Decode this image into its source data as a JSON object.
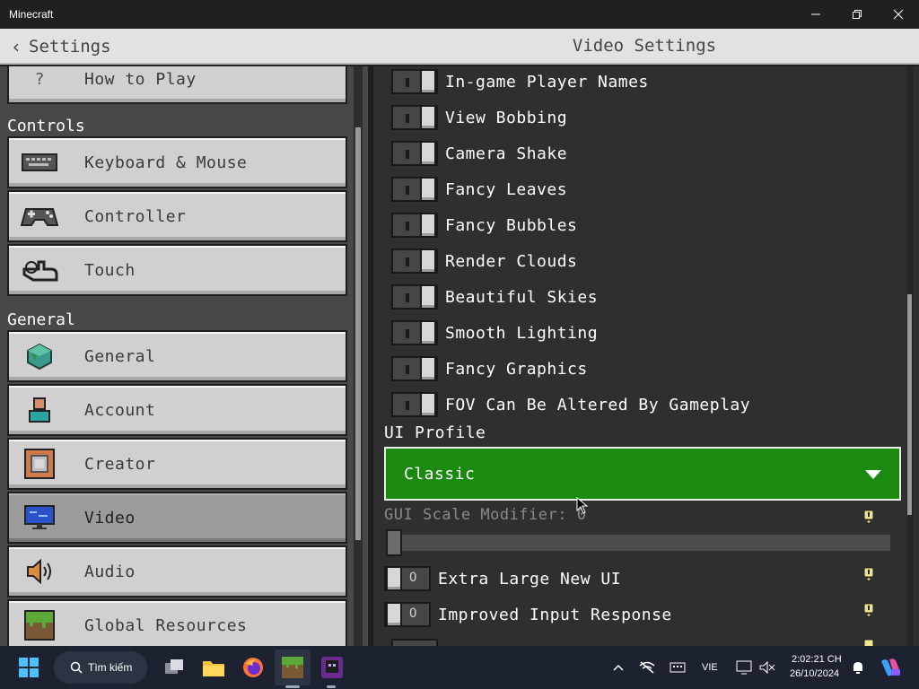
{
  "window": {
    "title": "Minecraft"
  },
  "header": {
    "back_label": "Settings",
    "title": "Video Settings"
  },
  "sidebar": {
    "partial_item": {
      "icon": "question-icon",
      "label": "How to Play",
      "icon_glyph": "?"
    },
    "sections": [
      {
        "title": "Controls",
        "items": [
          {
            "label": "Keyboard & Mouse",
            "icon": "keyboard-icon"
          },
          {
            "label": "Controller",
            "icon": "controller-icon"
          },
          {
            "label": "Touch",
            "icon": "touch-icon"
          }
        ]
      },
      {
        "title": "General",
        "items": [
          {
            "label": "General",
            "icon": "globe-cube-icon"
          },
          {
            "label": "Account",
            "icon": "account-icon"
          },
          {
            "label": "Creator",
            "icon": "creator-icon"
          },
          {
            "label": "Video",
            "icon": "monitor-icon",
            "selected": true
          },
          {
            "label": "Audio",
            "icon": "speaker-icon"
          },
          {
            "label": "Global Resources",
            "icon": "grass-block-icon"
          }
        ]
      }
    ]
  },
  "video": {
    "toggles": [
      {
        "label": "In-game Player Names",
        "state": "off"
      },
      {
        "label": "View Bobbing",
        "state": "off"
      },
      {
        "label": "Camera Shake",
        "state": "off"
      },
      {
        "label": "Fancy Leaves",
        "state": "off"
      },
      {
        "label": "Fancy Bubbles",
        "state": "off"
      },
      {
        "label": "Render Clouds",
        "state": "off"
      },
      {
        "label": "Beautiful Skies",
        "state": "off"
      },
      {
        "label": "Smooth Lighting",
        "state": "off"
      },
      {
        "label": "Fancy Graphics",
        "state": "off"
      },
      {
        "label": "FOV Can Be Altered By Gameplay",
        "state": "off"
      }
    ],
    "ui_profile_label": "UI Profile",
    "ui_profile_value": "Classic",
    "gui_scale_label": "GUI Scale Modifier: 0",
    "gui_scale_value": 0,
    "extra_toggles": [
      {
        "label": "Extra Large New UI",
        "state": "off",
        "glyph": "O"
      },
      {
        "label": "Improved Input Response",
        "state": "off",
        "glyph": "O"
      }
    ]
  },
  "taskbar": {
    "search_label": "Tìm kiếm",
    "language": "VIE",
    "time": "2:02:21 CH",
    "date": "26/10/2024"
  },
  "colors": {
    "dropdown_green": "#1a8a10",
    "button_gray": "#d0d0d0",
    "panel_dark": "#2f2f2f"
  }
}
